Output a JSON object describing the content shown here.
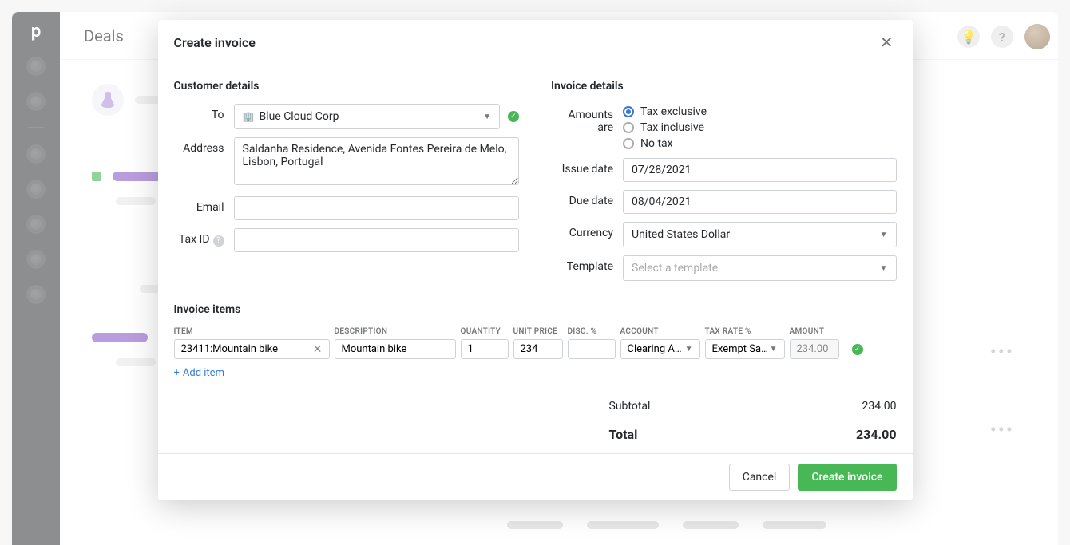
{
  "app": {
    "page_title": "Deals",
    "logo": "p"
  },
  "modal": {
    "title": "Create invoice",
    "sections": {
      "customer": "Customer details",
      "invoice": "Invoice details",
      "items": "Invoice items"
    },
    "customer": {
      "to_label": "To",
      "to_value": "Blue Cloud Corp",
      "address_label": "Address",
      "address_value": "Saldanha Residence, Avenida Fontes Pereira de Melo, Lisbon, Portugal",
      "email_label": "Email",
      "email_value": "",
      "taxid_label": "Tax ID",
      "taxid_value": ""
    },
    "invoice": {
      "amounts_label": "Amounts are",
      "amounts_options": {
        "exclusive": "Tax exclusive",
        "inclusive": "Tax inclusive",
        "notax": "No tax"
      },
      "amounts_selected": "exclusive",
      "issue_label": "Issue date",
      "issue_value": "07/28/2021",
      "due_label": "Due date",
      "due_value": "08/04/2021",
      "currency_label": "Currency",
      "currency_value": "United States Dollar",
      "template_label": "Template",
      "template_placeholder": "Select a template"
    },
    "items_headers": {
      "item": "ITEM",
      "description": "DESCRIPTION",
      "quantity": "QUANTITY",
      "unit_price": "UNIT PRICE",
      "disc": "DISC. %",
      "account": "ACCOUNT",
      "tax_rate": "TAX RATE %",
      "amount": "AMOUNT"
    },
    "line": {
      "item": "23411:Mountain bike",
      "description": "Mountain bike",
      "quantity": "1",
      "unit_price": "234",
      "disc": "",
      "account": "Clearing Acc…",
      "tax_rate": "Exempt Sale…",
      "amount": "234.00"
    },
    "add_item": "Add item",
    "totals": {
      "subtotal_label": "Subtotal",
      "subtotal_value": "234.00",
      "total_label": "Total",
      "total_value": "234.00"
    },
    "footer": {
      "cancel": "Cancel",
      "create": "Create invoice"
    }
  }
}
